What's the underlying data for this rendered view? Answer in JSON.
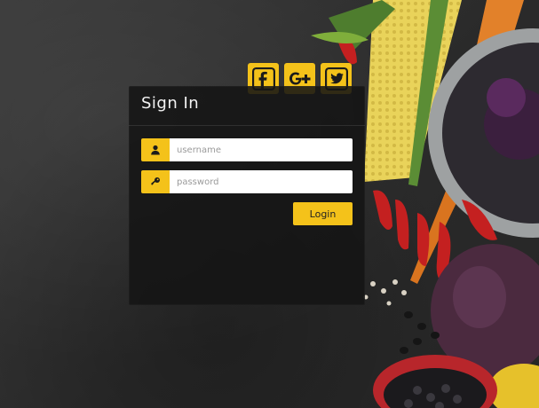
{
  "signin": {
    "title": "Sign In",
    "username_placeholder": "username",
    "password_placeholder": "password",
    "login_label": "Login"
  },
  "social": [
    {
      "icon": "facebook-icon"
    },
    {
      "icon": "google-plus-icon"
    },
    {
      "icon": "twitter-icon"
    }
  ],
  "colors": {
    "accent": "#f4c21a",
    "panel": "#141414",
    "background": "#2f2f2f"
  }
}
